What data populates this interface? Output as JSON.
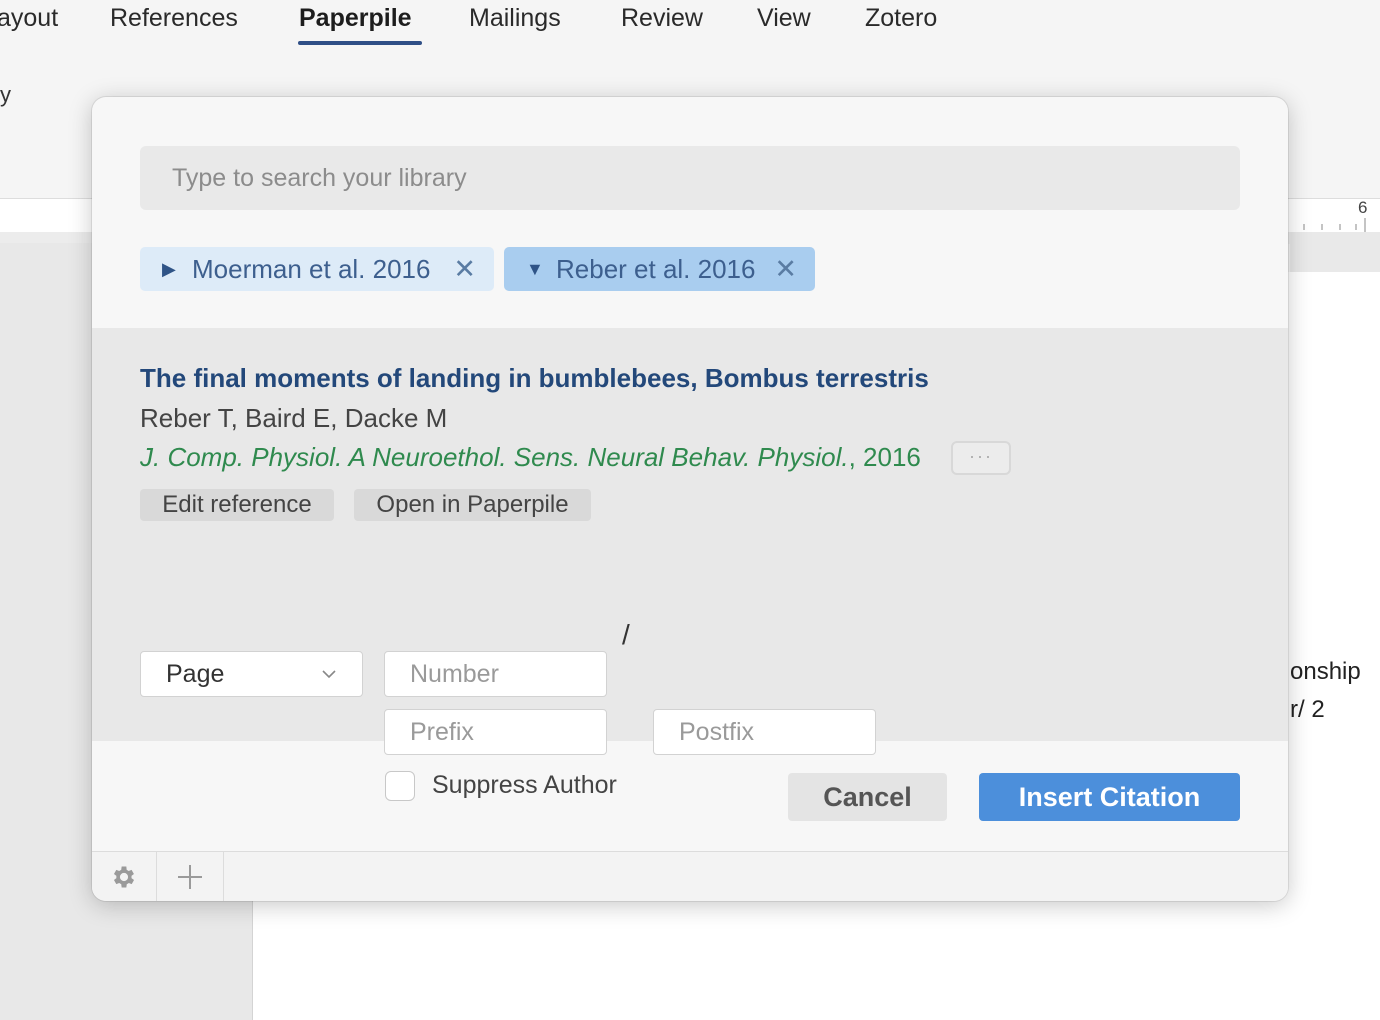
{
  "ribbon": {
    "tabs": [
      {
        "label": "ayout"
      },
      {
        "label": "References"
      },
      {
        "label": "Paperpile"
      },
      {
        "label": "Mailings"
      },
      {
        "label": "Review"
      },
      {
        "label": "View"
      },
      {
        "label": "Zotero"
      }
    ],
    "active_tab": "Paperpile",
    "left_fragment": "y"
  },
  "ruler": {
    "number": "6"
  },
  "document": {
    "fragments": [
      "onship",
      "r/ 2"
    ]
  },
  "dialog": {
    "search": {
      "placeholder": "Type to search your library",
      "value": ""
    },
    "chips": [
      {
        "label": "Moerman et al. 2016",
        "expanded": false,
        "remove": "✕"
      },
      {
        "label": "Reber et al. 2016",
        "expanded": true,
        "remove": "✕"
      }
    ],
    "reference": {
      "title": "The final moments of landing in bumblebees, Bombus terrestris",
      "authors": "Reber T, Baird E, Dacke M",
      "journal": "J. Comp. Physiol. A Neuroethol. Sens. Neural Behav. Physiol.",
      "year_suffix": ", 2016",
      "more_label": "···",
      "edit_label": "Edit reference",
      "open_label": "Open in Paperpile"
    },
    "locator": {
      "type_value": "Page",
      "number_placeholder": "Number",
      "prefix_placeholder": "Prefix",
      "separator": "/",
      "postfix_placeholder": "Postfix",
      "suppress_label": "Suppress Author",
      "suppress_checked": false
    },
    "actions": {
      "cancel_label": "Cancel",
      "insert_label": "Insert Citation"
    },
    "footer": {
      "icons": [
        "gear-icon",
        "plus-icon"
      ]
    },
    "colors": {
      "accent": "#4c8fdb",
      "title": "#23487a",
      "journal": "#2f8a4e",
      "chip_selected": "#a9cdef",
      "chip": "#ddebf8"
    }
  }
}
